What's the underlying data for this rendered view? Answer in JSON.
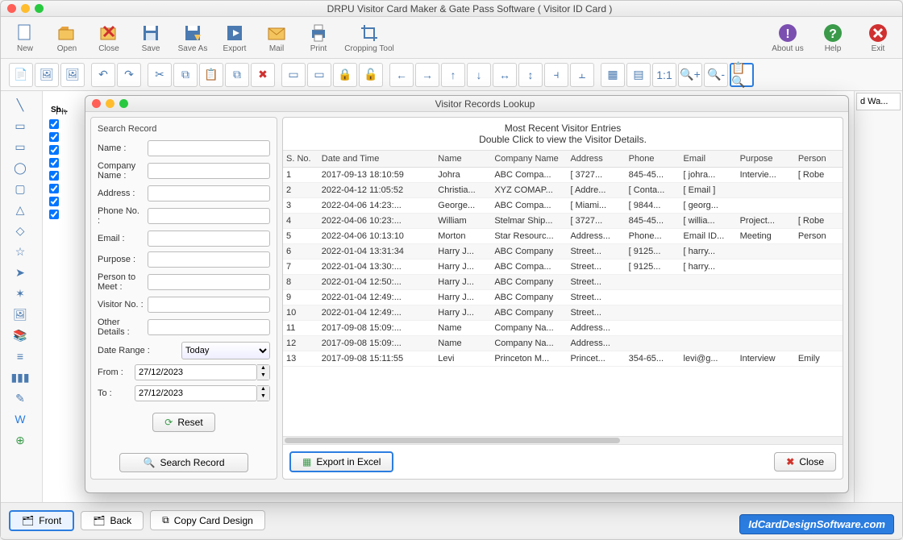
{
  "window": {
    "title": "DRPU Visitor Card Maker & Gate Pass Software ( Visitor ID Card )"
  },
  "toolbar": {
    "new": "New",
    "open": "Open",
    "close": "Close",
    "save": "Save",
    "saveas": "Save As",
    "export": "Export",
    "mail": "Mail",
    "print": "Print",
    "crop": "Cropping Tool",
    "about": "About us",
    "help": "Help",
    "exit": "Exit"
  },
  "sidepanel_tab": "d Wa...",
  "shapes_header": "Sh...",
  "bottom": {
    "front": "Front",
    "back": "Back",
    "copy": "Copy Card Design"
  },
  "watermark": "IdCardDesignSoftware.com",
  "canvas_label": "Ph",
  "modal": {
    "title": "Visitor Records Lookup",
    "search_title": "Search Record",
    "fields": {
      "name": "Name :",
      "company": "Company Name :",
      "address": "Address :",
      "phone": "Phone No. :",
      "email": "Email :",
      "purpose": "Purpose :",
      "person": "Person to Meet :",
      "visitorno": "Visitor No. :",
      "other": "Other Details :",
      "daterange": "Date Range :",
      "from": "From :",
      "to": "To :"
    },
    "daterange_value": "Today",
    "from_value": "27/12/2023",
    "to_value": "27/12/2023",
    "reset": "Reset",
    "search": "Search Record",
    "results_title1": "Most Recent Visitor Entries",
    "results_title2": "Double Click to view the Visitor Details.",
    "columns": [
      "S. No.",
      "Date and Time",
      "Name",
      "Company Name",
      "Address",
      "Phone",
      "Email",
      "Purpose",
      "Person"
    ],
    "rows": [
      {
        "n": "1",
        "dt": "2017-09-13 18:10:59",
        "name": "Johra",
        "comp": "ABC Compa...",
        "addr": "[ 3727...",
        "phone": "845-45...",
        "email": "[ johra...",
        "purp": "Intervie...",
        "pers": "[ Robe"
      },
      {
        "n": "2",
        "dt": "2022-04-12 11:05:52",
        "name": "Christia...",
        "comp": "XYZ COMAP...",
        "addr": "[ Addre...",
        "phone": "[ Conta...",
        "email": "[ Email ]",
        "purp": "",
        "pers": ""
      },
      {
        "n": "3",
        "dt": "2022-04-06 14:23:...",
        "name": "George...",
        "comp": "ABC Compa...",
        "addr": "[ Miami...",
        "phone": "[ 9844...",
        "email": "[ georg...",
        "purp": "",
        "pers": ""
      },
      {
        "n": "4",
        "dt": "2022-04-06 10:23:...",
        "name": "William",
        "comp": "Stelmar Ship...",
        "addr": "[ 3727...",
        "phone": "845-45...",
        "email": "[ willia...",
        "purp": "Project...",
        "pers": "[ Robe"
      },
      {
        "n": "5",
        "dt": "2022-04-06 10:13:10",
        "name": "Morton",
        "comp": "Star Resourc...",
        "addr": "Address...",
        "phone": "Phone...",
        "email": "Email ID...",
        "purp": "Meeting",
        "pers": "Person"
      },
      {
        "n": "6",
        "dt": "2022-01-04 13:31:34",
        "name": "Harry J...",
        "comp": "ABC Company",
        "addr": "Street...",
        "phone": "[ 9125...",
        "email": "[ harry...",
        "purp": "",
        "pers": ""
      },
      {
        "n": "7",
        "dt": "2022-01-04 13:30:...",
        "name": "Harry J...",
        "comp": "ABC Compa...",
        "addr": "Street...",
        "phone": "[ 9125...",
        "email": "[ harry...",
        "purp": "",
        "pers": ""
      },
      {
        "n": "8",
        "dt": "2022-01-04 12:50:...",
        "name": "Harry J...",
        "comp": "ABC Company",
        "addr": "Street...",
        "phone": "",
        "email": "",
        "purp": "",
        "pers": ""
      },
      {
        "n": "9",
        "dt": "2022-01-04 12:49:...",
        "name": "Harry J...",
        "comp": "ABC Company",
        "addr": "Street...",
        "phone": "",
        "email": "",
        "purp": "",
        "pers": ""
      },
      {
        "n": "10",
        "dt": "2022-01-04 12:49:...",
        "name": "Harry J...",
        "comp": "ABC Company",
        "addr": "Street...",
        "phone": "",
        "email": "",
        "purp": "",
        "pers": ""
      },
      {
        "n": "11",
        "dt": "2017-09-08 15:09:...",
        "name": "Name",
        "comp": "Company Na...",
        "addr": "Address...",
        "phone": "",
        "email": "",
        "purp": "",
        "pers": ""
      },
      {
        "n": "12",
        "dt": "2017-09-08 15:09:...",
        "name": "Name",
        "comp": "Company Na...",
        "addr": "Address...",
        "phone": "",
        "email": "",
        "purp": "",
        "pers": ""
      },
      {
        "n": "13",
        "dt": "2017-09-08 15:11:55",
        "name": "Levi",
        "comp": "Princeton M...",
        "addr": "Princet...",
        "phone": "354-65...",
        "email": "levi@g...",
        "purp": "Interview",
        "pers": "Emily"
      }
    ],
    "export": "Export  in Excel",
    "close": "Close"
  }
}
